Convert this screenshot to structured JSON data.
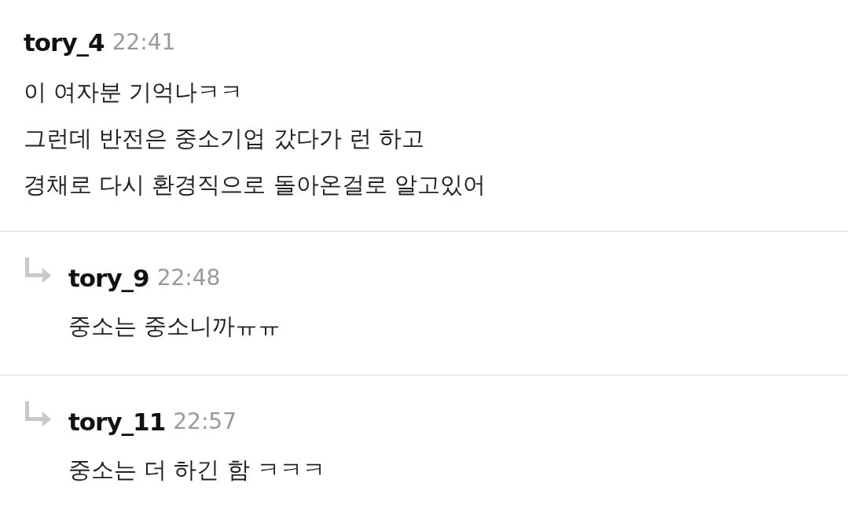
{
  "comments": [
    {
      "kind": "comment",
      "author": "tory_4",
      "time": "22:41",
      "lines": [
        "이 여자분 기억나ㅋㅋ",
        "그런데 반전은 중소기업 갔다가 런 하고",
        "경채로 다시 환경직으로 돌아온걸로 알고있어"
      ]
    },
    {
      "kind": "reply",
      "author": "tory_9",
      "time": "22:48",
      "lines": [
        "중소는 중소니까ㅠㅠ"
      ]
    },
    {
      "kind": "reply",
      "author": "tory_11",
      "time": "22:57",
      "lines": [
        "중소는 더 하긴 함 ㅋㅋㅋ"
      ]
    }
  ]
}
